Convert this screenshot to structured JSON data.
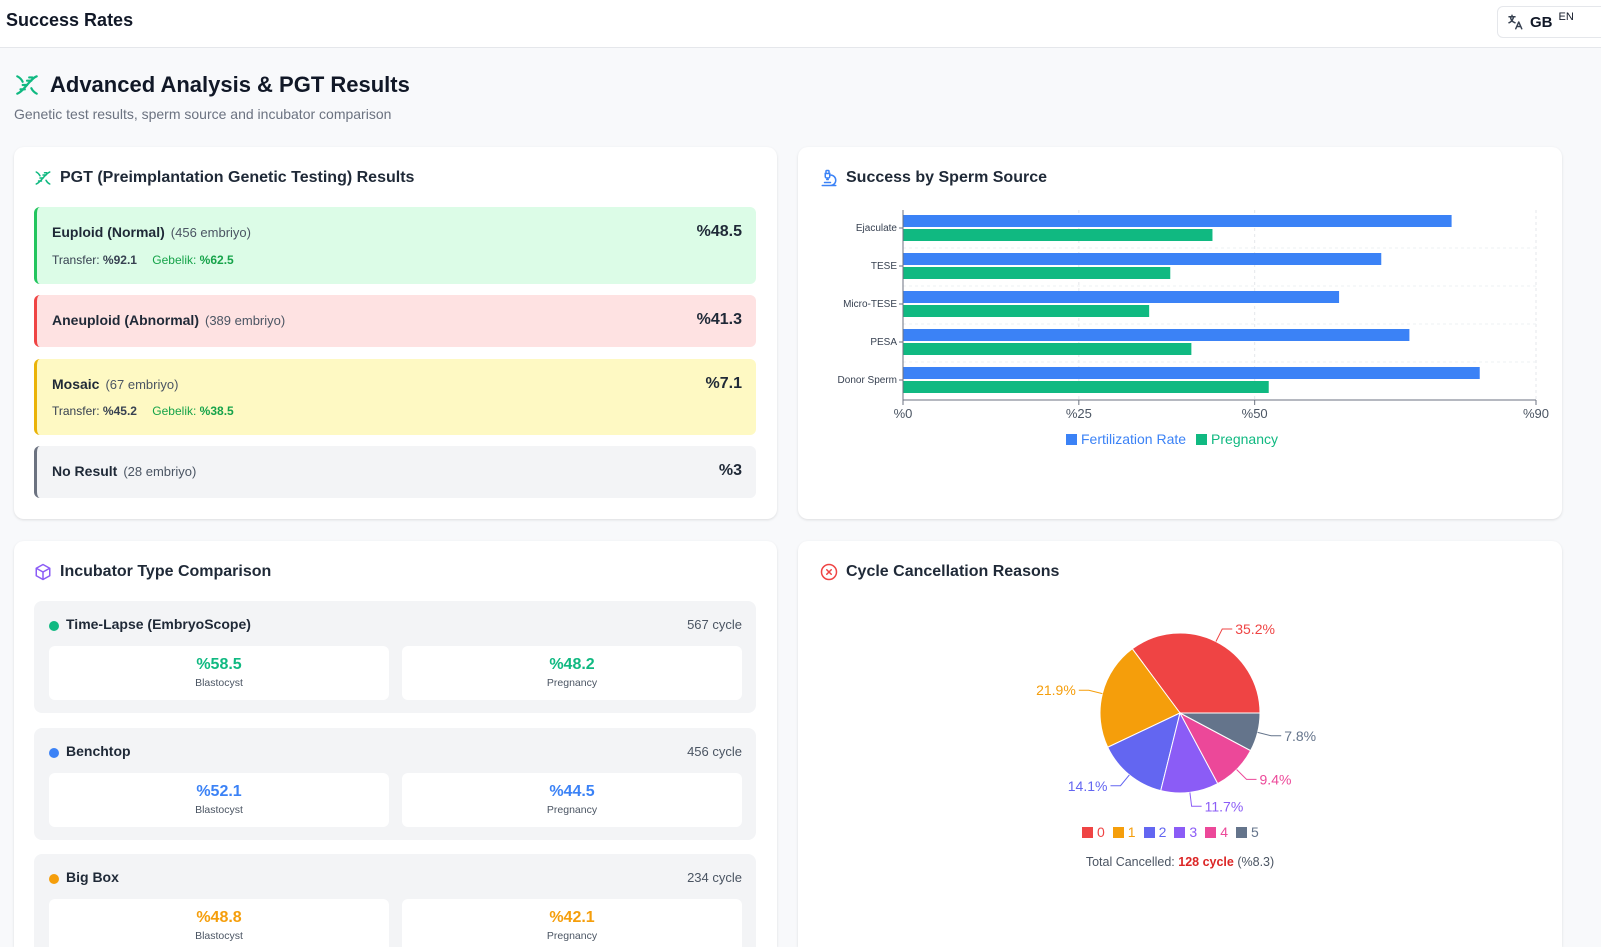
{
  "topbar": {
    "title": "Success Rates",
    "lang_code": "GB",
    "lang_name": "EN"
  },
  "section": {
    "title": "Advanced Analysis & PGT Results",
    "subtitle": "Genetic test results, sperm source and incubator comparison"
  },
  "pgt": {
    "title": "PGT (Preimplantation Genetic Testing) Results",
    "rows": [
      {
        "name": "Euploid (Normal)",
        "count": "(456 embriyo)",
        "pct": "%48.5",
        "transfer_label": "Transfer:",
        "transfer": "%92.1",
        "pregnancy_label": "Gebelik:",
        "pregnancy": "%62.5",
        "bg": "#dcfce7",
        "border": "#22c55e"
      },
      {
        "name": "Aneuploid (Abnormal)",
        "count": "(389 embriyo)",
        "pct": "%41.3",
        "bg": "#fee2e2",
        "border": "#ef4444"
      },
      {
        "name": "Mosaic",
        "count": "(67 embriyo)",
        "pct": "%7.1",
        "transfer_label": "Transfer:",
        "transfer": "%45.2",
        "pregnancy_label": "Gebelik:",
        "pregnancy": "%38.5",
        "bg": "#fef9c3",
        "border": "#eab308"
      },
      {
        "name": "No Result",
        "count": "(28 embriyo)",
        "pct": "%3",
        "bg": "#f3f4f6",
        "border": "#6b7280"
      }
    ]
  },
  "sperm": {
    "title": "Success by Sperm Source",
    "chart_data": {
      "type": "bar",
      "orientation": "horizontal",
      "categories": [
        "Ejaculate",
        "TESE",
        "Micro-TESE",
        "PESA",
        "Donor Sperm"
      ],
      "series": [
        {
          "name": "Fertilization Rate",
          "color": "#3b82f6",
          "values": [
            78,
            68,
            62,
            72,
            82
          ]
        },
        {
          "name": "Pregnancy",
          "color": "#10b981",
          "values": [
            44,
            38,
            35,
            41,
            52
          ]
        }
      ],
      "xlim": [
        0,
        90
      ],
      "xticks": [
        0,
        25,
        50,
        90
      ],
      "xtick_labels": [
        "%0",
        "%25",
        "%50",
        "%90"
      ],
      "grid": true,
      "legend": "bottom"
    }
  },
  "incubator": {
    "title": "Incubator Type Comparison",
    "items": [
      {
        "name": "Time-Lapse (EmbryoScope)",
        "cycles": "567 cycle",
        "color": "#10b981",
        "blast": "%58.5",
        "blast_label": "Blastocyst",
        "preg": "%48.2",
        "preg_label": "Pregnancy"
      },
      {
        "name": "Benchtop",
        "cycles": "456 cycle",
        "color": "#3b82f6",
        "blast": "%52.1",
        "blast_label": "Blastocyst",
        "preg": "%44.5",
        "preg_label": "Pregnancy"
      },
      {
        "name": "Big Box",
        "cycles": "234 cycle",
        "color": "#f59e0b",
        "blast": "%48.8",
        "blast_label": "Blastocyst",
        "preg": "%42.1",
        "preg_label": "Pregnancy"
      }
    ]
  },
  "cancel": {
    "title": "Cycle Cancellation Reasons",
    "chart_data": {
      "type": "pie",
      "labels": [
        "0",
        "1",
        "2",
        "3",
        "4",
        "5"
      ],
      "values": [
        35.2,
        21.9,
        14.1,
        11.7,
        9.4,
        7.8
      ],
      "value_labels": [
        "35.2%",
        "21.9%",
        "14.1%",
        "11.7%",
        "9.4%",
        "7.8%"
      ],
      "colors": [
        "#ef4444",
        "#f59e0b",
        "#6366f1",
        "#8b5cf6",
        "#ec4899",
        "#64748b"
      ],
      "legend": "bottom"
    },
    "total_label": "Total Cancelled:",
    "total_value": "128 cycle",
    "total_pct": "(%8.3)"
  }
}
